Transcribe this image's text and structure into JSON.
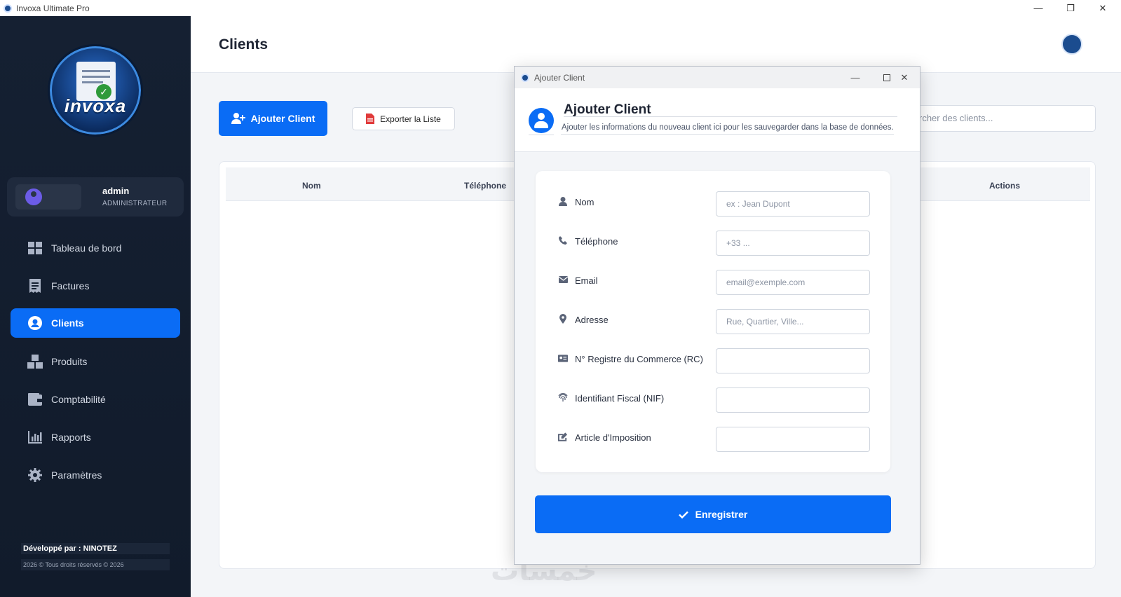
{
  "window": {
    "title": "Invoxa Ultimate Pro",
    "minimize": "—",
    "maximize": "❐",
    "close": "✕"
  },
  "sidebar": {
    "logo_text": "invoxa",
    "user": {
      "name": "admin",
      "role": "ADMINISTRATEUR"
    },
    "items": [
      {
        "label": "Tableau de bord",
        "icon": "dashboard-icon"
      },
      {
        "label": "Factures",
        "icon": "receipt-icon"
      },
      {
        "label": "Clients",
        "icon": "user-circle-icon",
        "active": true
      },
      {
        "label": "Produits",
        "icon": "boxes-icon"
      },
      {
        "label": "Comptabilité",
        "icon": "wallet-icon"
      },
      {
        "label": "Rapports",
        "icon": "chart-icon"
      },
      {
        "label": "Paramètres",
        "icon": "gear-icon"
      }
    ],
    "footer": {
      "developer": "Développé par : NINOTEZ",
      "copyright": "2026 © Tous droits réservés © 2026"
    }
  },
  "main": {
    "title": "Clients",
    "add_button": "Ajouter Client",
    "export_button": "Exporter la Liste",
    "search_placeholder": "rcher des clients...",
    "table": {
      "columns": [
        "Nom",
        "Téléphone",
        "Actions"
      ]
    }
  },
  "dialog": {
    "window_title": "Ajouter Client",
    "heading": "Ajouter Client",
    "subtitle": "Ajouter les informations du nouveau client ici pour les sauvegarder dans la base de données.",
    "fields": [
      {
        "label": "Nom",
        "placeholder": "ex : Jean Dupont",
        "icon": "person-icon"
      },
      {
        "label": "Téléphone",
        "placeholder": "+33 ...",
        "icon": "phone-icon"
      },
      {
        "label": "Email",
        "placeholder": "email@exemple.com",
        "icon": "envelope-icon"
      },
      {
        "label": "Adresse",
        "placeholder": "Rue, Quartier, Ville...",
        "icon": "map-pin-icon"
      },
      {
        "label": "N° Registre du Commerce (RC)",
        "placeholder": "",
        "icon": "id-card-icon"
      },
      {
        "label": "Identifiant Fiscal (NIF)",
        "placeholder": "",
        "icon": "fingerprint-icon"
      },
      {
        "label": "Article d'Imposition",
        "placeholder": "",
        "icon": "signature-icon"
      }
    ],
    "save_button": "Enregistrer"
  },
  "colors": {
    "accent": "#0a6cf5",
    "sidebar_bg": "#152032"
  }
}
